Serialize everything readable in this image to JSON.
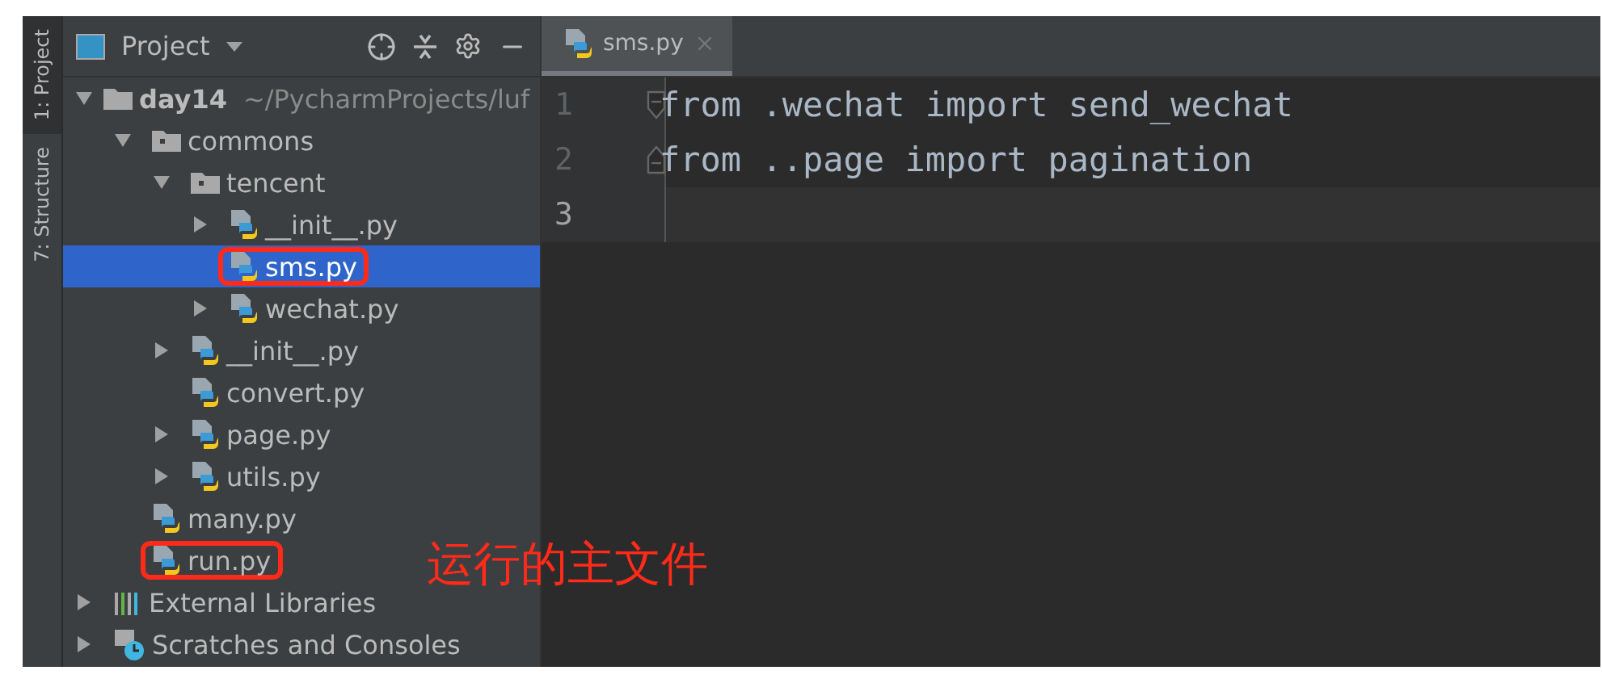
{
  "side_stripe": [
    {
      "label": "1: Project",
      "selected": true
    },
    {
      "label": "7: Structure",
      "selected": false
    }
  ],
  "project_panel": {
    "title": "Project"
  },
  "tree": [
    {
      "kind": "folder",
      "label": "day14",
      "path": "~/PycharmProjects/luf",
      "expanded": true,
      "selected": false,
      "children": [
        {
          "kind": "package",
          "label": "commons",
          "expanded": true,
          "selected": false,
          "children": [
            {
              "kind": "package",
              "label": "tencent",
              "expanded": true,
              "selected": false,
              "children": [
                {
                  "kind": "python",
                  "label": "__init__.py",
                  "expanded": false,
                  "selected": false
                },
                {
                  "kind": "python",
                  "label": "sms.py",
                  "selected": true,
                  "annotated": true
                },
                {
                  "kind": "python",
                  "label": "wechat.py",
                  "expanded": false,
                  "selected": false
                }
              ]
            },
            {
              "kind": "python",
              "label": "__init__.py",
              "expanded": false,
              "selected": false
            },
            {
              "kind": "python",
              "label": "convert.py",
              "selected": false
            },
            {
              "kind": "python",
              "label": "page.py",
              "expanded": false,
              "selected": false
            },
            {
              "kind": "python",
              "label": "utils.py",
              "expanded": false,
              "selected": false
            }
          ]
        },
        {
          "kind": "python",
          "label": "many.py",
          "selected": false
        },
        {
          "kind": "python",
          "label": "run.py",
          "selected": false,
          "annotated": true,
          "note": "运行的主文件"
        }
      ]
    },
    {
      "kind": "libraries",
      "label": "External Libraries",
      "expanded": false,
      "selected": false
    },
    {
      "kind": "scratches",
      "label": "Scratches and Consoles",
      "expanded": false,
      "selected": false
    }
  ],
  "editor": {
    "tabs": [
      {
        "label": "sms.py",
        "selected": true
      }
    ],
    "lines": [
      {
        "number": "1",
        "code": "from .wechat import send_wechat",
        "kind": "fold-start",
        "current": false
      },
      {
        "number": "2",
        "code": "from ..page import pagination",
        "kind": "fold-end",
        "current": false
      },
      {
        "number": "3",
        "kind": "plain",
        "current": true
      }
    ]
  }
}
